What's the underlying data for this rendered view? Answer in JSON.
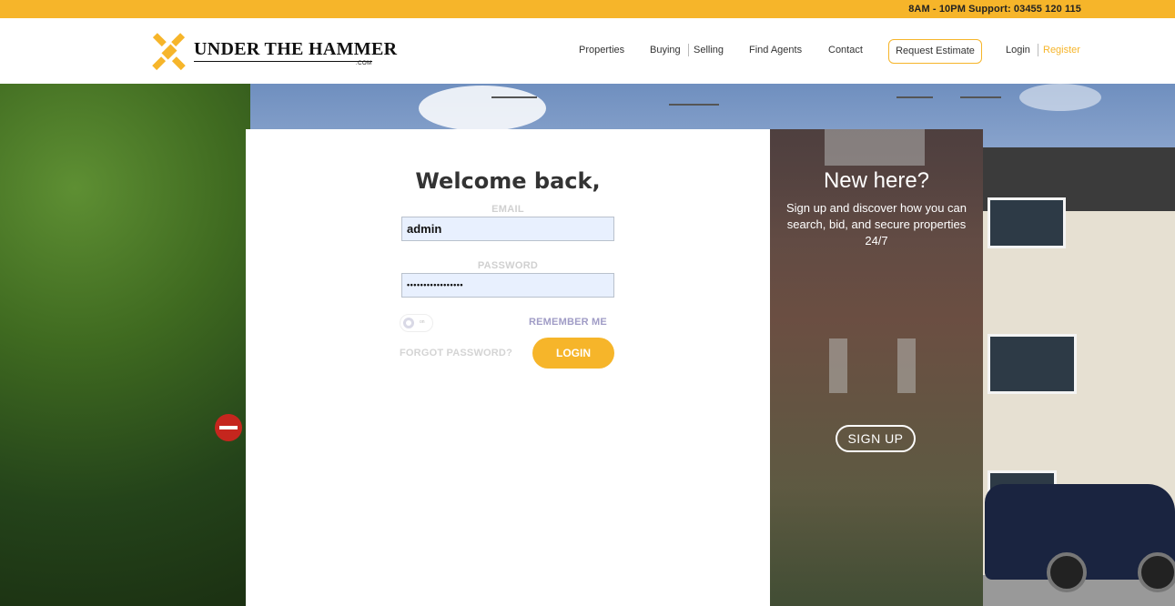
{
  "topbar": {
    "support": "8AM - 10PM Support: 03455 120 115"
  },
  "brand": {
    "name": "UNDER THE HAMMER",
    "suffix": ".COM",
    "accent": "#f6b52a"
  },
  "nav": {
    "properties": "Properties",
    "buying": "Buying",
    "selling": "Selling",
    "find_agents": "Find Agents",
    "contact": "Contact",
    "request_estimate": "Request Estimate",
    "login": "Login",
    "register": "Register"
  },
  "login_form": {
    "title": "Welcome back,",
    "email_label": "EMAIL",
    "email_value": "admin",
    "password_label": "PASSWORD",
    "password_value": "•••••••••••••••••",
    "toggle_text": "on",
    "remember_label": "REMEMBER ME",
    "forgot_label": "FORGOT PASSWORD?",
    "login_label": "LOGIN"
  },
  "signup_panel": {
    "title": "New here?",
    "text": "Sign up and discover how you can search, bid, and secure properties 24/7",
    "button": "SIGN UP"
  }
}
